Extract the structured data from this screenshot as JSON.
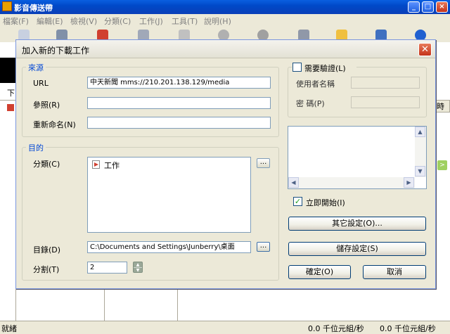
{
  "app": {
    "title": "影音傳送帶"
  },
  "menu": [
    "檔案(F)",
    "編輯(E)",
    "檢視(V)",
    "分類(C)",
    "工作(J)",
    "工具(T)",
    "說明(H)"
  ],
  "background": {
    "tab_label": "下",
    "column_label": "時"
  },
  "status": {
    "left": "就緒",
    "speed1": "0.0 千位元組/秒",
    "speed2": "0.0 千位元組/秒"
  },
  "dialog": {
    "title": "加入新的下載工作",
    "source": {
      "legend": "來源",
      "url_label": "URL",
      "url_value": "中天新聞 mms://210.201.138.129/media",
      "referer_label": "參照(R)",
      "referer_value": "",
      "rename_label": "重新命名(N)",
      "rename_value": ""
    },
    "dest": {
      "legend": "目的",
      "category_label": "分類(C)",
      "category_item": "工作",
      "browse_label": "...",
      "dir_label": "目錄(D)",
      "dir_value": "C:\\Documents and Settings\\Junberry\\桌面",
      "split_label": "分割(T)",
      "split_value": "2"
    },
    "auth": {
      "checkbox_label": "需要驗證(L)",
      "checked": false,
      "username_label": "使用者名稱",
      "password_label": "密 碼(P)"
    },
    "start_now": {
      "label": "立即開始(I)",
      "checked": true
    },
    "buttons": {
      "other_settings": "其它設定(O)...",
      "save_settings": "儲存設定(S)",
      "ok": "確定(O)",
      "cancel": "取消"
    }
  }
}
